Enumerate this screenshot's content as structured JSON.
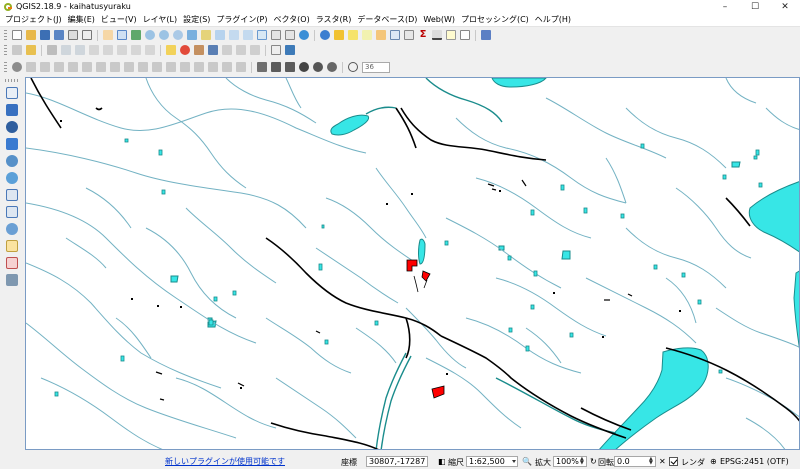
{
  "window": {
    "title": "QGIS2.18.9 - kaihatusyuraku",
    "minimize": "–",
    "maximize": "☐",
    "close": "✕"
  },
  "menu": [
    "プロジェクト(J)",
    "編集(E)",
    "ビュー(V)",
    "レイヤ(L)",
    "設定(S)",
    "プラグイン(P)",
    "ベクタ(O)",
    "ラスタ(R)",
    "データベース(D)",
    "Web(W)",
    "プロセッシング(C)",
    "ヘルプ(H)"
  ],
  "toolbar3": {
    "rotation_value": "36"
  },
  "status": {
    "plugin_message": "新しいプラグインが使用可能です",
    "coordinate_label": "座標",
    "coordinate_value": "30807,-17287",
    "scale_label": "縮尺",
    "scale_value": "1:62,500",
    "magnifier_label": "拡大",
    "magnifier_value": "100%",
    "rotation_label": "回転",
    "rotation_value": "0.0",
    "render_label": "レンダ",
    "crs_label": "EPSG:2451 (OTF)"
  },
  "colors": {
    "water_fill": "#37e6e6",
    "stream": "#73b2c3",
    "road": "#000000",
    "river_outline": "#1a8c8c",
    "building": "#ff0000",
    "map_border": "#7a9bc4",
    "link": "#0033cc"
  },
  "icons": {
    "app": "qgis-logo-icon",
    "left_tools": [
      "add-vector-layer-icon",
      "add-raster-layer-icon",
      "add-postgis-layer-icon",
      "add-spatialite-layer-icon",
      "add-mssql-layer-icon",
      "add-wms-layer-icon",
      "add-wcs-layer-icon",
      "add-wfs-layer-icon",
      "add-delimited-text-icon",
      "new-shapefile-icon",
      "new-virtual-layer-icon",
      "gps-tools-icon"
    ]
  }
}
